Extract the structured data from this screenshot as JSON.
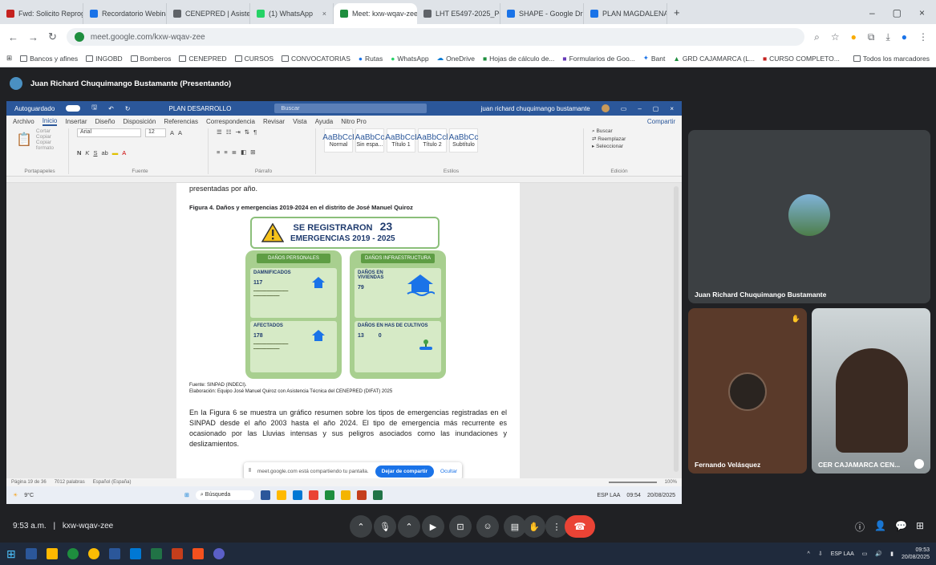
{
  "browser": {
    "tabs": [
      {
        "label": "Fwd: Solicito Reprograma",
        "color": "#c5221f"
      },
      {
        "label": "Recordatorio Webinar CE",
        "color": "#1a73e8"
      },
      {
        "label": "CENEPRED | Asistencia",
        "color": "#5f6368"
      },
      {
        "label": "(1) WhatsApp",
        "color": "#25d366"
      },
      {
        "label": "Meet: kxw-wqav-zee",
        "color": "#1e8e3e",
        "active": true
      },
      {
        "label": "LHT E5497-2025_POI.pdf",
        "color": "#5f6368"
      },
      {
        "label": "SHAPE - Google Drive",
        "color": "#1a73e8"
      },
      {
        "label": "PLAN MAGDALENA 18.0",
        "color": "#1a73e8"
      }
    ],
    "url": "meet.google.com/kxw-wqav-zee",
    "bookmarks": [
      "Bancos y afines",
      "INGOBD",
      "Bomberos",
      "CENEPRED",
      "CURSOS",
      "CONVOCATORIAS",
      "Rutas",
      "WhatsApp",
      "OneDrive",
      "Hojas de cálculo de...",
      "Formularios de Goo...",
      "Bant",
      "GRD CAJAMARCA (L...",
      "CURSO COMPLETO..."
    ],
    "all_bookmarks": "Todos los marcadores"
  },
  "meet": {
    "presenter_label": "Juan Richard Chuquimango Bustamante (Presentando)",
    "meeting_time": "9:53 a.m.",
    "meeting_code": "kxw-wqav-zee",
    "participants": [
      {
        "name": "Juan Richard Chuquimango Bustamante"
      },
      {
        "name": "Fernando Velásquez"
      },
      {
        "name": "CER CAJAMARCA CEN..."
      }
    ]
  },
  "word": {
    "autosave": "Autoguardado",
    "doc_title": "PLAN DESARROLLO",
    "search": "Buscar",
    "user": "juan richard chuquimango bustamante",
    "menu": [
      "Archivo",
      "Inicio",
      "Insertar",
      "Diseño",
      "Disposición",
      "Referencias",
      "Correspondencia",
      "Revisar",
      "Vista",
      "Ayuda",
      "Nitro Pro"
    ],
    "share": "Compartir",
    "font": "Arial",
    "font_size": "12",
    "styles": [
      {
        "sample": "AaBbCcI",
        "name": "Normal"
      },
      {
        "sample": "AaBbCc",
        "name": "Sin espa..."
      },
      {
        "sample": "AaBbCcI",
        "name": "Título 1"
      },
      {
        "sample": "AaBbCcl",
        "name": "Título 2"
      },
      {
        "sample": "AaBbCc",
        "name": "Subtítulo"
      }
    ],
    "groups": [
      "Portapapeles",
      "Fuente",
      "Párrafo",
      "Estilos",
      "Edición"
    ],
    "page_top_text": "presentadas por año.",
    "figure_caption": "Figura 4. Daños y emergencias 2019-2024 en el distrito de José Manuel Quiroz",
    "infographic": {
      "header_line1": "SE REGISTRARON",
      "header_count": "23",
      "header_line2": "EMERGENCIAS 2019 - 2025",
      "left_panel": "DAÑOS PERSONALES",
      "right_panel": "DAÑOS INFRAESTRUCTURA",
      "damnificados_title": "DAMNIFICADOS",
      "damnificados_value": "117",
      "afectados_title": "AFECTADOS",
      "afectados_value": "178",
      "viviendas_title": "DAÑOS EN VIVIENDAS",
      "viviendas_value": "79",
      "cultivos_title": "DAÑOS EN HAS DE CULTIVOS",
      "cultivos_value1": "13",
      "cultivos_value2": "0"
    },
    "source_line": "Fuente: SINPAD (INDECI).",
    "elaboration_line": "Elaboración: Equipo José Manuel Quiroz con Asistencia Técnica del CENEPRED (DIFAT) 2025",
    "body_text": "En la Figura 6 se muestra un gráfico resumen sobre los tipos de emergencias registradas en el SINPAD desde el año 2003 hasta el año 2024. El tipo de emergencia más recurrente es ocasionado por las Lluvias intensas y sus peligros asociados como las inundaciones y deslizamientos.",
    "share_notice": "meet.google.com está compartiendo tu pantalla.",
    "stop_share": "Dejar de compartir",
    "hide": "Ocultar",
    "status_page": "Página 19 de 36",
    "status_words": "7012 palabras",
    "status_lang": "Español (España)",
    "zoom": "100%",
    "inner_taskbar_weather": "9°C",
    "inner_taskbar_search": "Búsqueda",
    "inner_time": "09:54",
    "inner_date": "20/08/2025",
    "inner_lang": "ESP LAA"
  },
  "taskbar": {
    "lang": "ESP LAA",
    "time": "09:53",
    "date": "20/08/2025"
  }
}
